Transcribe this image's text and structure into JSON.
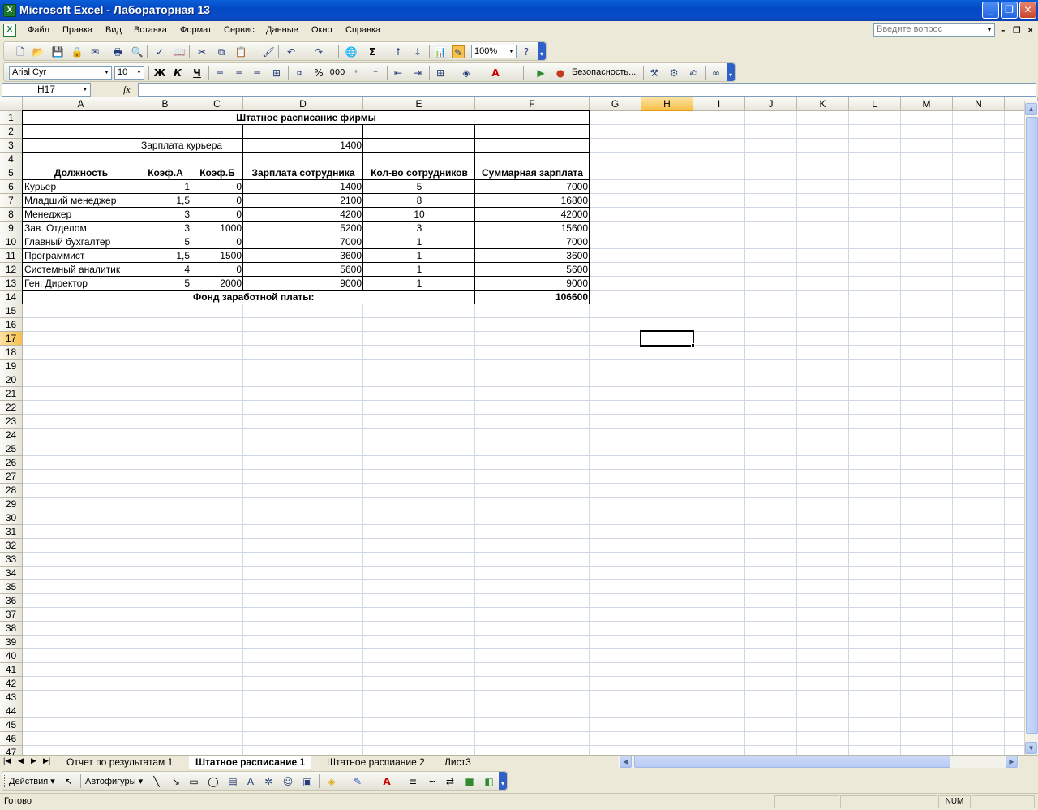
{
  "window": {
    "title": "Microsoft Excel - Лабораторная 13"
  },
  "menu": {
    "items": [
      "Файл",
      "Правка",
      "Вид",
      "Вставка",
      "Формат",
      "Сервис",
      "Данные",
      "Окно",
      "Справка"
    ],
    "help_placeholder": "Введите вопрос"
  },
  "toolbar": {
    "zoom": "100%",
    "font": "Arial Cyr",
    "size": "10",
    "bold": "Ж",
    "italic": "К",
    "underline": "Ч",
    "security": "Безопасность...",
    "sigma": "Σ",
    "percent": "%",
    "thousands": "000"
  },
  "formula_bar": {
    "name_box": "H17",
    "fx": "fx",
    "content": ""
  },
  "columns": [
    "A",
    "B",
    "C",
    "D",
    "E",
    "F",
    "G",
    "H",
    "I",
    "J",
    "K",
    "L",
    "M",
    "N"
  ],
  "selected_cell": {
    "col": "H",
    "row": 17
  },
  "sheet": {
    "title": "Штатное расписание фирмы",
    "courier_salary_label": "Зарплата курьера",
    "courier_salary": "1400",
    "headers": [
      "Должность",
      "Коэф.А",
      "Коэф.Б",
      "Зарплата сотрудника",
      "Кол-во сотрудников",
      "Суммарная зарплата"
    ],
    "rows": [
      [
        "Курьер",
        "1",
        "0",
        "1400",
        "5",
        "7000"
      ],
      [
        "Младший  менеджер",
        "1,5",
        "0",
        "2100",
        "8",
        "16800"
      ],
      [
        "Менеджер",
        "3",
        "0",
        "4200",
        "10",
        "42000"
      ],
      [
        "Зав. Отделом",
        "3",
        "1000",
        "5200",
        "3",
        "15600"
      ],
      [
        "Главный бухгалтер",
        "5",
        "0",
        "7000",
        "1",
        "7000"
      ],
      [
        "Программист",
        "1,5",
        "1500",
        "3600",
        "1",
        "3600"
      ],
      [
        "Системный аналитик",
        "4",
        "0",
        "5600",
        "1",
        "5600"
      ],
      [
        "Ген. Директор",
        "5",
        "2000",
        "9000",
        "1",
        "9000"
      ]
    ],
    "fund_label": "Фонд заработной платы:",
    "fund_total": "106600"
  },
  "sheet_tabs": [
    "Отчет по результатам 1",
    "Штатное расписание 1",
    "Штатное распиание 2",
    "Лист3"
  ],
  "active_tab": 1,
  "drawing": {
    "actions": "Действия",
    "autoshapes": "Автофигуры"
  },
  "status": {
    "text": "Готово",
    "num": "NUM"
  }
}
